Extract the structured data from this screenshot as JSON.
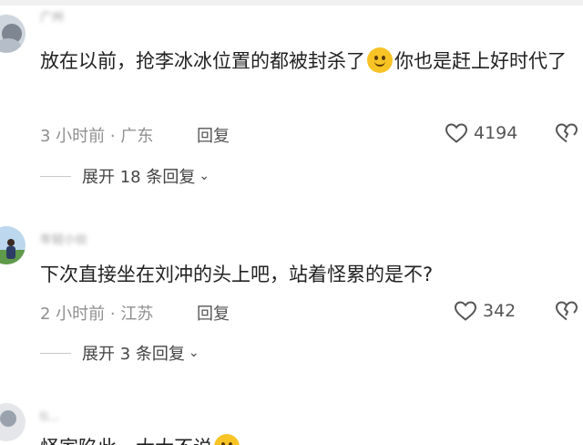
{
  "comments": [
    {
      "username": "广州",
      "text_before": "放在以前，抢李冰冰位置的都被封杀了",
      "text_after": "你也是赶上好时代了",
      "emoji": "smile-emoji",
      "meta": "3 小时前 · 广东",
      "reply_label": "回复",
      "likes": "4194",
      "expand_label": "展开 18 条回复"
    },
    {
      "username": "年轻小伙",
      "text_before": "下次直接坐在刘冲的头上吧，站着怪累的是不?",
      "meta": "2 小时前 · 江苏",
      "reply_label": "回复",
      "likes": "342",
      "expand_label": "展开 3 条回复"
    },
    {
      "username": "ti...",
      "text_before": "怪家陷此，大大不说"
    }
  ],
  "icons": {
    "like": "heart-outline-icon",
    "dislike": "broken-heart-icon",
    "expand": "chevron-down-icon"
  },
  "colors": {
    "text": "#222222",
    "meta": "#8f8f8f",
    "emoji": "#f7c325"
  }
}
